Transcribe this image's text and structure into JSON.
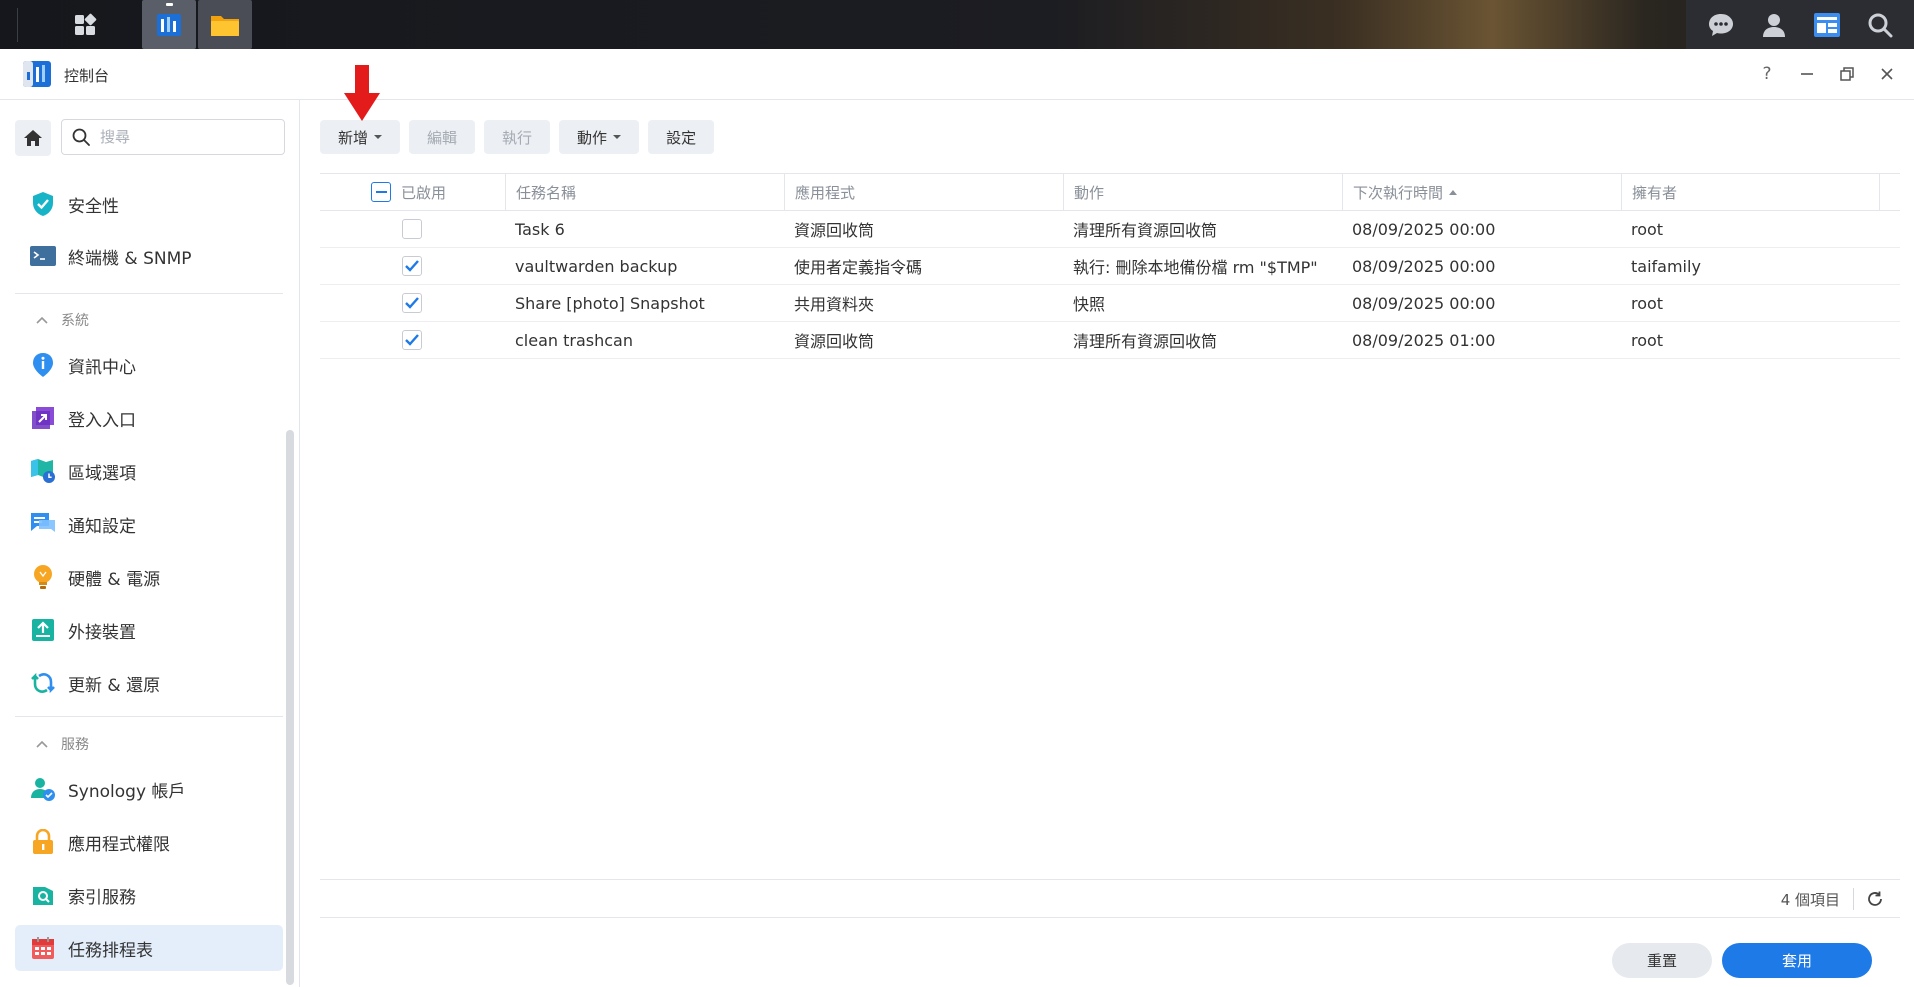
{
  "taskbar": {
    "icons": [
      "apps-grid-icon",
      "control-panel-icon",
      "file-station-icon",
      "chat-icon",
      "user-icon",
      "widgets-icon",
      "search-icon"
    ]
  },
  "window": {
    "title": "控制台",
    "controls": [
      "help-icon",
      "minimize-icon",
      "restore-icon",
      "close-icon"
    ],
    "help_label": "?"
  },
  "sidebar": {
    "search_placeholder": "搜尋",
    "items_top": [
      {
        "label": "安全性",
        "icon": "shield-icon"
      },
      {
        "label": "終端機 & SNMP",
        "icon": "terminal-icon"
      }
    ],
    "section_system": "系統",
    "items_system": [
      {
        "label": "資訊中心",
        "icon": "info-icon"
      },
      {
        "label": "登入入口",
        "icon": "login-portal-icon"
      },
      {
        "label": "區域選項",
        "icon": "region-icon"
      },
      {
        "label": "通知設定",
        "icon": "notification-icon"
      },
      {
        "label": "硬體 & 電源",
        "icon": "bulb-icon"
      },
      {
        "label": "外接裝置",
        "icon": "external-device-icon"
      },
      {
        "label": "更新 & 還原",
        "icon": "update-icon"
      }
    ],
    "section_services": "服務",
    "items_services": [
      {
        "label": "Synology 帳戶",
        "icon": "synology-account-icon"
      },
      {
        "label": "應用程式權限",
        "icon": "lock-icon"
      },
      {
        "label": "索引服務",
        "icon": "index-icon"
      },
      {
        "label": "任務排程表",
        "icon": "calendar-icon",
        "active": true
      }
    ]
  },
  "toolbar": {
    "create": "新增",
    "edit": "編輯",
    "run": "執行",
    "action": "動作",
    "settings": "設定"
  },
  "table": {
    "headers": {
      "enabled": "已啟用",
      "task_name": "任務名稱",
      "application": "應用程式",
      "action": "動作",
      "next_run": "下次執行時間",
      "owner": "擁有者"
    },
    "rows": [
      {
        "enabled": false,
        "task_name": "Task 6",
        "application": "資源回收筒",
        "action": "清理所有資源回收筒",
        "next_run": "08/09/2025 00:00",
        "owner": "root"
      },
      {
        "enabled": true,
        "task_name": "vaultwarden backup",
        "application": "使用者定義指令碼",
        "action": "執行: 刪除本地備份檔 rm \"$TMP\"",
        "next_run": "08/09/2025 00:00",
        "owner": "taifamily"
      },
      {
        "enabled": true,
        "task_name": "Share [photo] Snapshot",
        "application": "共用資料夾",
        "action": "快照",
        "next_run": "08/09/2025 00:00",
        "owner": "root"
      },
      {
        "enabled": true,
        "task_name": "clean trashcan",
        "application": "資源回收筒",
        "action": "清理所有資源回收筒",
        "next_run": "08/09/2025 01:00",
        "owner": "root"
      }
    ]
  },
  "footer": {
    "count": "4 個項目",
    "reset": "重置",
    "apply": "套用"
  },
  "colors": {
    "accent": "#1e7ae6",
    "annotation_arrow": "#e31b1b"
  }
}
